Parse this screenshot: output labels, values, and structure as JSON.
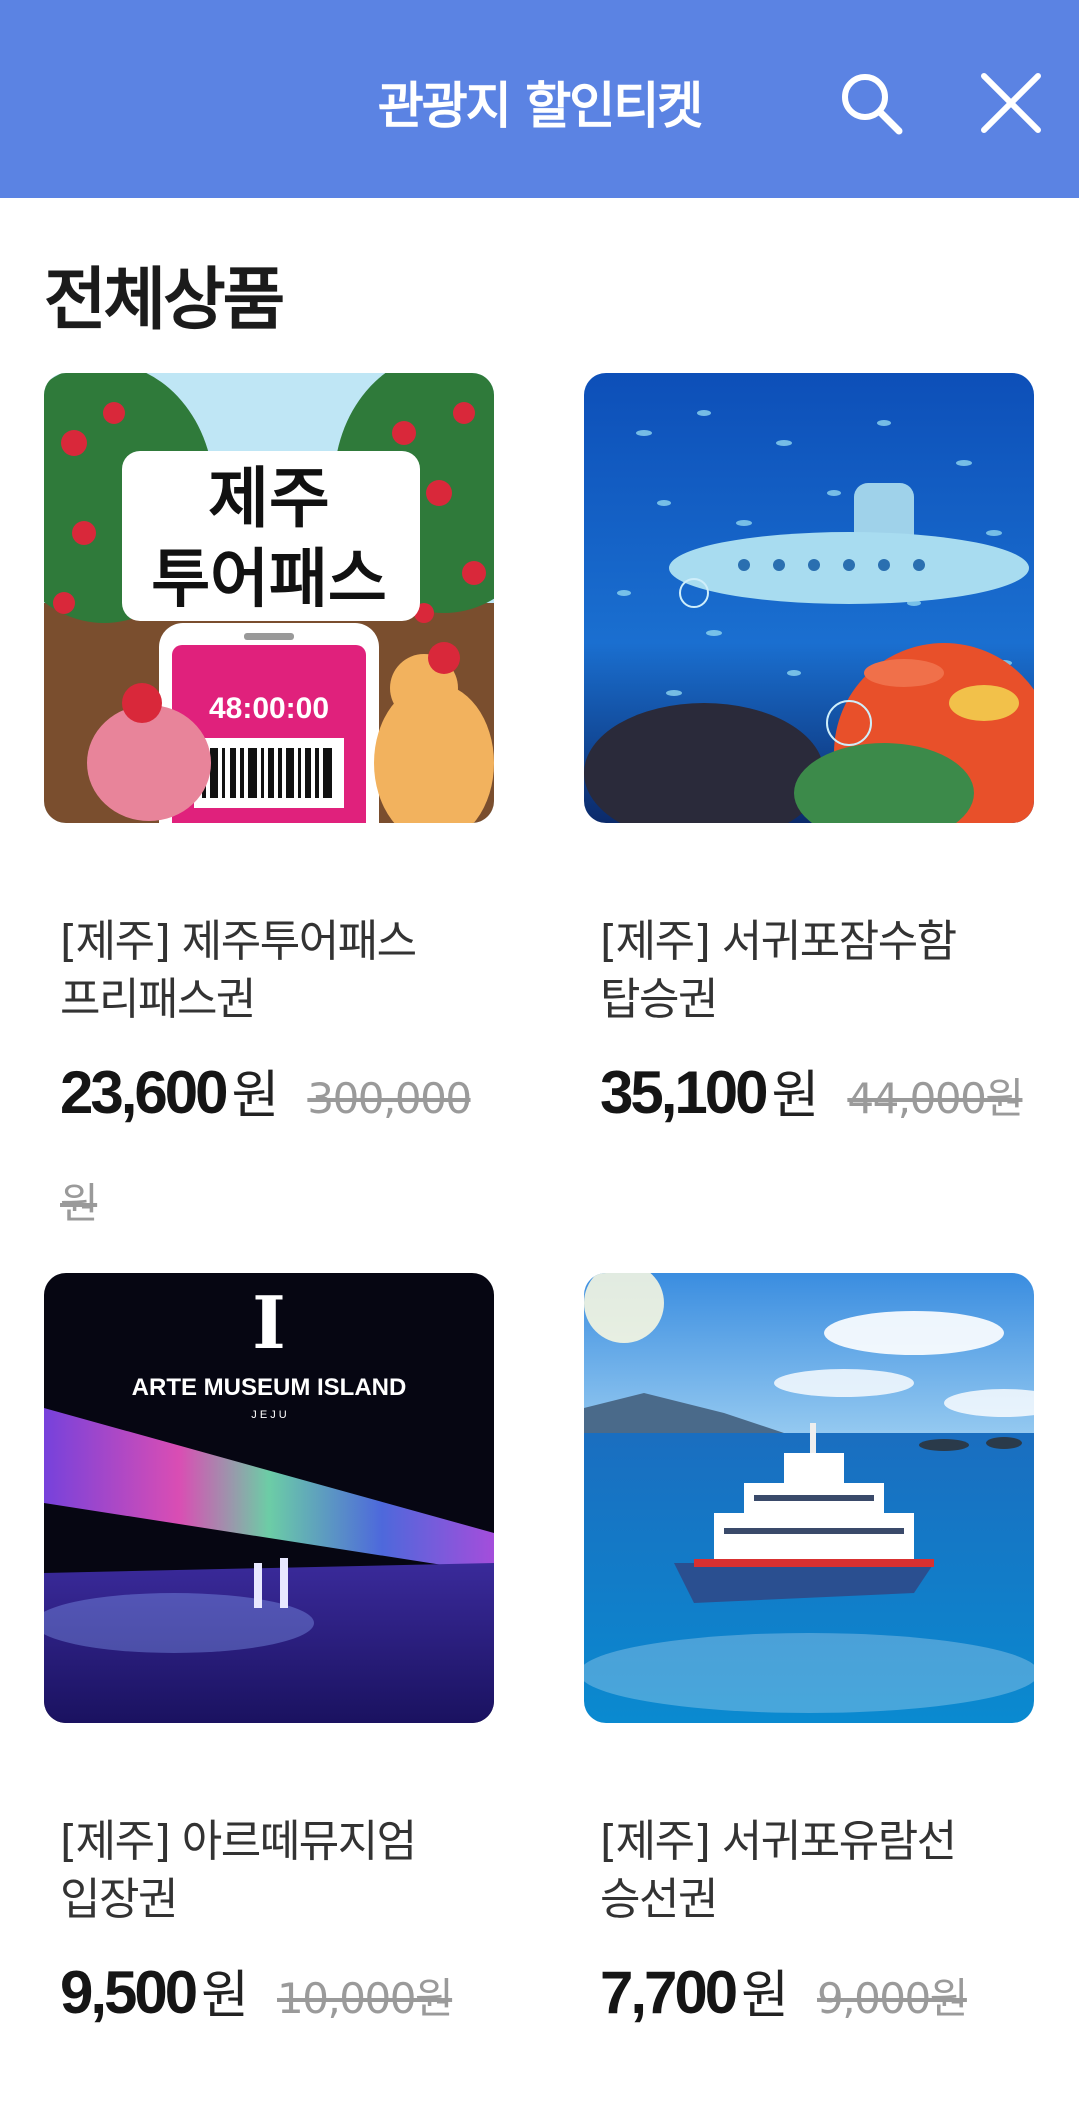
{
  "header": {
    "title": "관광지 할인티켓",
    "search_icon": "search-icon",
    "close_icon": "close-icon"
  },
  "section": {
    "title": "전체상품"
  },
  "colors": {
    "header_bg": "#5b83e3",
    "header_text": "#ffffff"
  },
  "products": [
    {
      "name": "[제주] 제주투어패스 프리패스권",
      "price": "23,600",
      "won": "원",
      "original": "300,000원",
      "image": {
        "title_line1": "제주",
        "title_line2": "투어패스",
        "timer": "48:00:00"
      }
    },
    {
      "name": "[제주] 서귀포잠수함 탑승권",
      "price": "35,100",
      "won": "원",
      "original": "44,000원",
      "image": {}
    },
    {
      "name": "[제주] 아르떼뮤지엄 입장권",
      "price": "9,500",
      "won": "원",
      "original": "10,000원",
      "image": {
        "letter": "I",
        "title": "ARTE MUSEUM ISLAND",
        "subtitle": "J E J U"
      }
    },
    {
      "name": "[제주] 서귀포유람선 승선권",
      "price": "7,700",
      "won": "원",
      "original": "9,000원",
      "image": {}
    }
  ]
}
